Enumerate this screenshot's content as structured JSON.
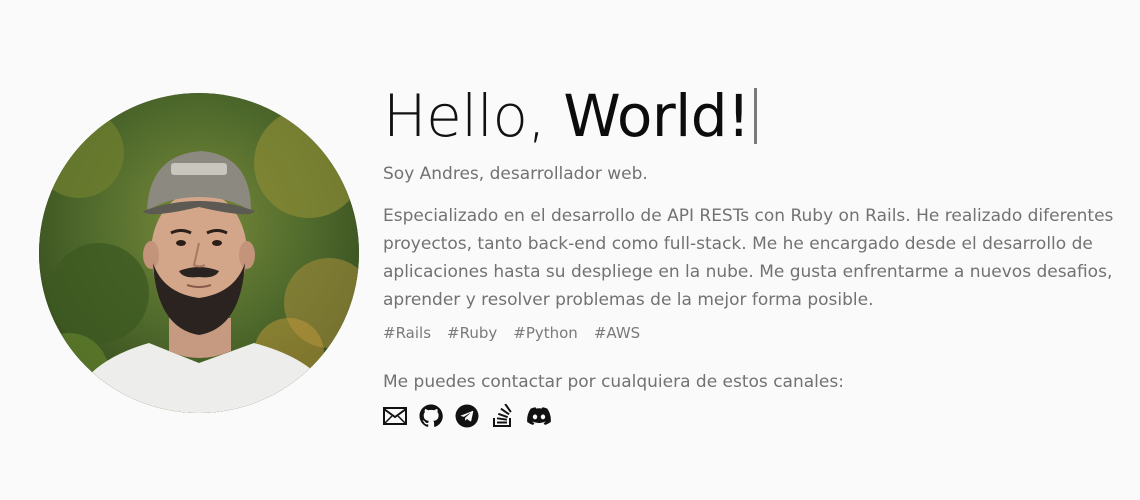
{
  "hero": {
    "greeting": "Hello, ",
    "highlight": "World!"
  },
  "subtitle": "Soy Andres, desarrollador web.",
  "bio": "Especializado en el desarrollo de API RESTs con Ruby on Rails. He realizado diferentes proyectos, tanto back-end como full-stack. Me he encargado desde el desarrollo de aplicaciones hasta su despliege en la nube. Me gusta enfrentarme a nuevos desafios, aprender y resolver problemas de la mejor forma posible.",
  "tags": [
    "#Rails",
    "#Ruby",
    "#Python",
    "#AWS"
  ],
  "contact": {
    "text": "Me puedes contactar por cualquiera de estos canales:",
    "channels": [
      "mail-icon",
      "github-icon",
      "telegram-icon",
      "stackoverflow-icon",
      "discord-icon"
    ]
  },
  "colors": {
    "background": "#fafafa",
    "heading": "#111111",
    "body_text": "#727272"
  }
}
